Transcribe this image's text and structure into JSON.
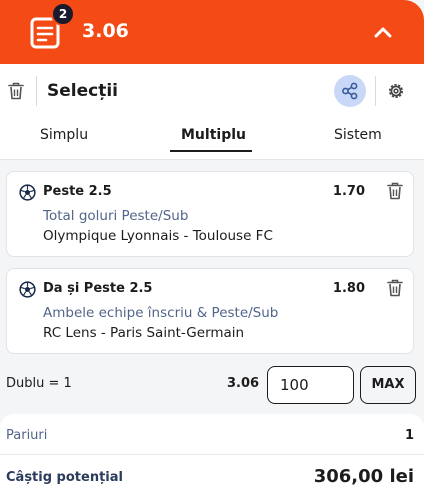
{
  "header": {
    "badge_count": "2",
    "total_odds": "3.06",
    "color": "#f44b16"
  },
  "panel": {
    "title": "Selecții",
    "tabs": [
      {
        "label": "Simplu",
        "active": false
      },
      {
        "label": "Multiplu",
        "active": true
      },
      {
        "label": "Sistem",
        "active": false
      }
    ]
  },
  "selections": [
    {
      "pick": "Peste 2.5",
      "odds": "1.70",
      "market": "Total goluri Peste/Sub",
      "match": "Olympique Lyonnais - Toulouse FC"
    },
    {
      "pick": "Da și Peste 2.5",
      "odds": "1.80",
      "market": "Ambele echipe înscriu & Peste/Sub",
      "match": "RC Lens - Paris Saint-Germain"
    }
  ],
  "bet": {
    "combo_label": "Dublu = 1",
    "combo_odds": "3.06",
    "stake_value": "100",
    "max_label": "MAX"
  },
  "summary": {
    "bets_label": "Pariuri",
    "bets_value": "1",
    "win_label": "Câștig potențial",
    "win_value": "306,00 lei"
  }
}
